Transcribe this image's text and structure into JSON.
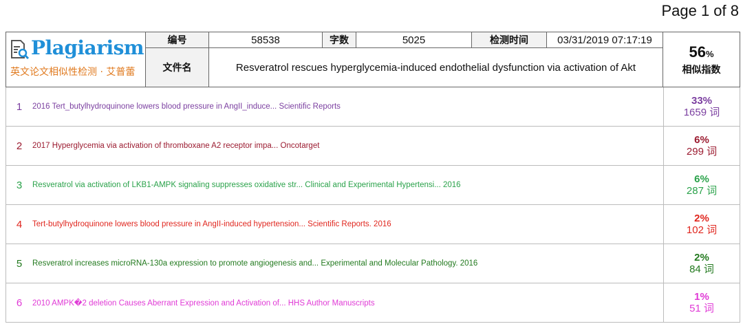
{
  "page_indicator": "Page 1 of 8",
  "logo": {
    "name": "Plagiarism",
    "subtitle": "英文论文相似性检测 · 艾普蕾",
    "icon": "document-search-icon"
  },
  "header": {
    "id_label": "编号",
    "id_value": "58538",
    "words_label": "字数",
    "words_value": "5025",
    "time_label": "检测时间",
    "time_value": "03/31/2019 07:17:19",
    "file_label": "文件名",
    "file_value": "Resveratrol rescues hyperglycemia-induced endothelial dysfunction via activation of Akt",
    "similarity_value": "56",
    "similarity_unit": "%",
    "similarity_label": "相似指数"
  },
  "sources": [
    {
      "index": "1",
      "title": "2016 Tert_butylhydroquinone lowers blood pressure in AngII_induce... Scientific Reports",
      "percent": "33%",
      "words": "1659 词",
      "color": "#7b3fa0"
    },
    {
      "index": "2",
      "title": "2017 Hyperglycemia via activation of thromboxane A2 receptor impa... Oncotarget",
      "percent": "6%",
      "words": "299 词",
      "color": "#9b1b30"
    },
    {
      "index": "3",
      "title": "Resveratrol via activation of LKB1-AMPK signaling suppresses oxidative str... Clinical and Experimental Hypertensi... 2016",
      "percent": "6%",
      "words": "287 词",
      "color": "#2aa24a"
    },
    {
      "index": "4",
      "title": "Tert-butylhydroquinone lowers blood pressure in AngII-induced hypertension... Scientific Reports. 2016",
      "percent": "2%",
      "words": "102 词",
      "color": "#e0261e"
    },
    {
      "index": "5",
      "title": "Resveratrol increases microRNA-130a expression to promote angiogenesis and... Experimental and Molecular Pathology. 2016",
      "percent": "2%",
      "words": "84 词",
      "color": "#237a1f"
    },
    {
      "index": "6",
      "title": "2010 AMPK�2 deletion Causes Aberrant Expression and Activation of... HHS Author Manuscripts",
      "percent": "1%",
      "words": "51 词",
      "color": "#e03ad6"
    }
  ]
}
